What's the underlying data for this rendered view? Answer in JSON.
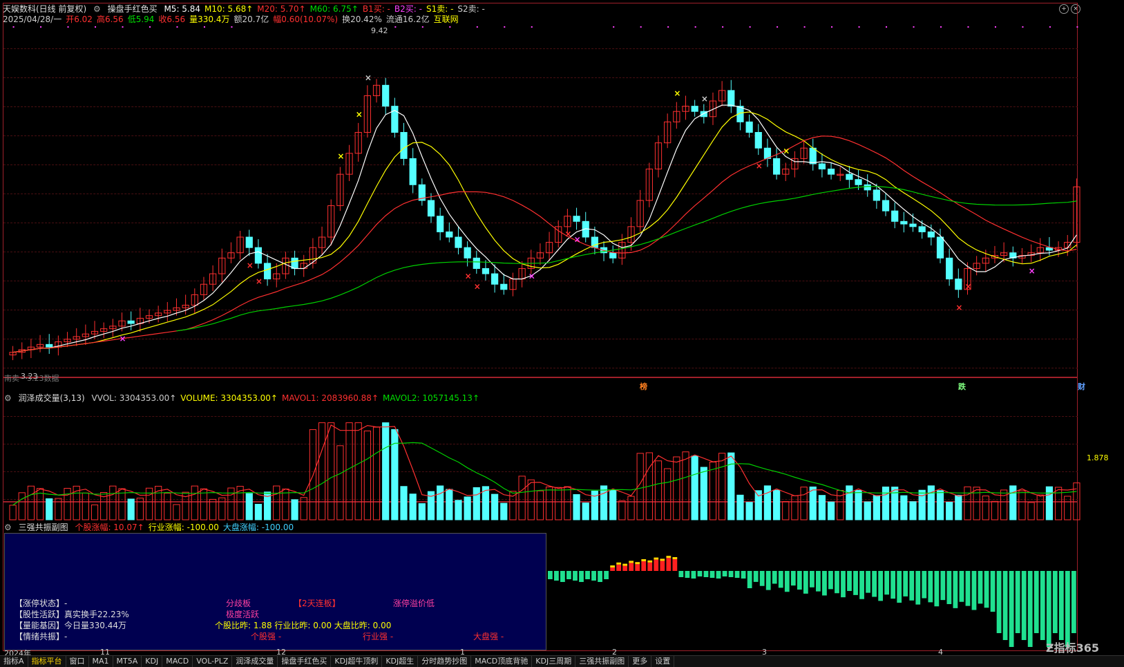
{
  "header": {
    "stock": "天娱数科(日线 前复权)",
    "indicator_name": "操盘手红色买",
    "ma_items": [
      {
        "label": "M5: 5.84",
        "color": "#ffffff"
      },
      {
        "label": "M10: 5.68↑",
        "color": "#ffff00"
      },
      {
        "label": "M20: 5.70↑",
        "color": "#ff3030"
      },
      {
        "label": "M60: 6.75↑",
        "color": "#00e000"
      },
      {
        "label": "B1买: -",
        "color": "#ff3030"
      },
      {
        "label": "B2买: -",
        "color": "#ff40ff"
      },
      {
        "label": "S1卖: -",
        "color": "#ffff00"
      },
      {
        "label": "S2卖: -",
        "color": "#cccccc"
      }
    ],
    "quote_items": [
      {
        "label": "2025/04/28/一",
        "color": "#cccccc"
      },
      {
        "label": "开6.02",
        "color": "#ff3030"
      },
      {
        "label": "高6.56",
        "color": "#ff3030"
      },
      {
        "label": "低5.94",
        "color": "#00e000"
      },
      {
        "label": "收6.56",
        "color": "#ff3030"
      },
      {
        "label": "量330.4万",
        "color": "#ffff00"
      },
      {
        "label": "额20.7亿",
        "color": "#cccccc"
      },
      {
        "label": "幅0.60(10.07%)",
        "color": "#ff3030"
      },
      {
        "label": "换20.42%",
        "color": "#cccccc"
      },
      {
        "label": "流通16.2亿",
        "color": "#cccccc"
      },
      {
        "label": "互联网",
        "color": "#ffff00"
      }
    ]
  },
  "main_chart": {
    "high_label": "9.42",
    "low_label": "3.23",
    "bottom_left_text": "南卖一3.23数据",
    "event_markers": [
      {
        "label": "榜",
        "color": "#ff8020"
      },
      {
        "label": "跌",
        "color": "#80ff80"
      },
      {
        "label": "财",
        "color": "#60a0ff"
      }
    ]
  },
  "volume_panel": {
    "title": "润泽成交量(3,13)",
    "items": [
      {
        "label": "VVOL: 3304353.00↑",
        "color": "#cccccc"
      },
      {
        "label": "VOLUME: 3304353.00↑",
        "color": "#ffff00"
      },
      {
        "label": "MAVOL1: 2083960.88↑",
        "color": "#ff3030"
      },
      {
        "label": "MAVOL2: 1057145.13↑",
        "color": "#00e000"
      }
    ],
    "level_label": "1.878"
  },
  "sub_panel": {
    "title": "三强共振副图",
    "items": [
      {
        "label": "个股涨幅: 10.07↑",
        "color": "#ff3030"
      },
      {
        "label": "行业涨幅: -100.00",
        "color": "#ffff00"
      },
      {
        "label": "大盘涨幅: -100.00",
        "color": "#40d0ff"
      }
    ],
    "info": {
      "limit_status": "【涨停状态】-",
      "activity": "【股性活跃】真实换手22.23%",
      "energy": "【量能基因】今日量330.44万",
      "sentiment": "【情绪共振】-",
      "tag_fenqi": "分歧板",
      "tag_jidu": "极度活跃",
      "tag_2day": "【2天连板】",
      "tag_yijia": "涨停溢价低",
      "ratio_line": "个股比昨: 1.88 行业比昨: 0.00 大盘比昨: 0.00",
      "strong_stock": "个股强 -",
      "strong_industry": "行业强 -",
      "strong_market": "大盘强 -"
    }
  },
  "date_axis": [
    "2024年",
    "11",
    "12",
    "1",
    "2",
    "3",
    "4"
  ],
  "tabs": [
    "指标A",
    "指标平台",
    "窗口",
    "MA1",
    "MT5A",
    "KDJ",
    "MACD",
    "VOL-PLZ",
    "润泽成交量",
    "操盘手红色买",
    "KDJ超牛顶刺",
    "KDJ超生",
    "分时趋势抄图",
    "MACD顶底背驰",
    "KDJ三周期",
    "三强共振副图",
    "更多",
    "设置"
  ],
  "watermark": "指标365"
}
